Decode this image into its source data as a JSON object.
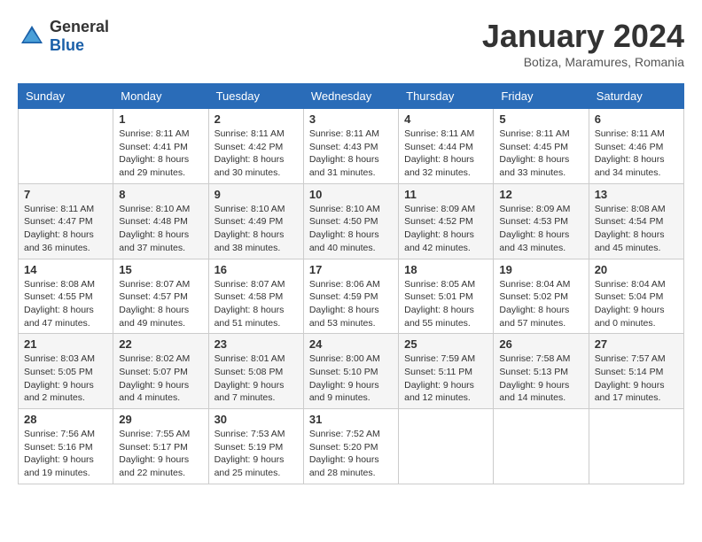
{
  "header": {
    "logo_general": "General",
    "logo_blue": "Blue",
    "month_title": "January 2024",
    "location": "Botiza, Maramures, Romania"
  },
  "weekdays": [
    "Sunday",
    "Monday",
    "Tuesday",
    "Wednesday",
    "Thursday",
    "Friday",
    "Saturday"
  ],
  "weeks": [
    [
      {
        "day": "",
        "sunrise": "",
        "sunset": "",
        "daylight": ""
      },
      {
        "day": "1",
        "sunrise": "Sunrise: 8:11 AM",
        "sunset": "Sunset: 4:41 PM",
        "daylight": "Daylight: 8 hours and 29 minutes."
      },
      {
        "day": "2",
        "sunrise": "Sunrise: 8:11 AM",
        "sunset": "Sunset: 4:42 PM",
        "daylight": "Daylight: 8 hours and 30 minutes."
      },
      {
        "day": "3",
        "sunrise": "Sunrise: 8:11 AM",
        "sunset": "Sunset: 4:43 PM",
        "daylight": "Daylight: 8 hours and 31 minutes."
      },
      {
        "day": "4",
        "sunrise": "Sunrise: 8:11 AM",
        "sunset": "Sunset: 4:44 PM",
        "daylight": "Daylight: 8 hours and 32 minutes."
      },
      {
        "day": "5",
        "sunrise": "Sunrise: 8:11 AM",
        "sunset": "Sunset: 4:45 PM",
        "daylight": "Daylight: 8 hours and 33 minutes."
      },
      {
        "day": "6",
        "sunrise": "Sunrise: 8:11 AM",
        "sunset": "Sunset: 4:46 PM",
        "daylight": "Daylight: 8 hours and 34 minutes."
      }
    ],
    [
      {
        "day": "7",
        "sunrise": "Sunrise: 8:11 AM",
        "sunset": "Sunset: 4:47 PM",
        "daylight": "Daylight: 8 hours and 36 minutes."
      },
      {
        "day": "8",
        "sunrise": "Sunrise: 8:10 AM",
        "sunset": "Sunset: 4:48 PM",
        "daylight": "Daylight: 8 hours and 37 minutes."
      },
      {
        "day": "9",
        "sunrise": "Sunrise: 8:10 AM",
        "sunset": "Sunset: 4:49 PM",
        "daylight": "Daylight: 8 hours and 38 minutes."
      },
      {
        "day": "10",
        "sunrise": "Sunrise: 8:10 AM",
        "sunset": "Sunset: 4:50 PM",
        "daylight": "Daylight: 8 hours and 40 minutes."
      },
      {
        "day": "11",
        "sunrise": "Sunrise: 8:09 AM",
        "sunset": "Sunset: 4:52 PM",
        "daylight": "Daylight: 8 hours and 42 minutes."
      },
      {
        "day": "12",
        "sunrise": "Sunrise: 8:09 AM",
        "sunset": "Sunset: 4:53 PM",
        "daylight": "Daylight: 8 hours and 43 minutes."
      },
      {
        "day": "13",
        "sunrise": "Sunrise: 8:08 AM",
        "sunset": "Sunset: 4:54 PM",
        "daylight": "Daylight: 8 hours and 45 minutes."
      }
    ],
    [
      {
        "day": "14",
        "sunrise": "Sunrise: 8:08 AM",
        "sunset": "Sunset: 4:55 PM",
        "daylight": "Daylight: 8 hours and 47 minutes."
      },
      {
        "day": "15",
        "sunrise": "Sunrise: 8:07 AM",
        "sunset": "Sunset: 4:57 PM",
        "daylight": "Daylight: 8 hours and 49 minutes."
      },
      {
        "day": "16",
        "sunrise": "Sunrise: 8:07 AM",
        "sunset": "Sunset: 4:58 PM",
        "daylight": "Daylight: 8 hours and 51 minutes."
      },
      {
        "day": "17",
        "sunrise": "Sunrise: 8:06 AM",
        "sunset": "Sunset: 4:59 PM",
        "daylight": "Daylight: 8 hours and 53 minutes."
      },
      {
        "day": "18",
        "sunrise": "Sunrise: 8:05 AM",
        "sunset": "Sunset: 5:01 PM",
        "daylight": "Daylight: 8 hours and 55 minutes."
      },
      {
        "day": "19",
        "sunrise": "Sunrise: 8:04 AM",
        "sunset": "Sunset: 5:02 PM",
        "daylight": "Daylight: 8 hours and 57 minutes."
      },
      {
        "day": "20",
        "sunrise": "Sunrise: 8:04 AM",
        "sunset": "Sunset: 5:04 PM",
        "daylight": "Daylight: 9 hours and 0 minutes."
      }
    ],
    [
      {
        "day": "21",
        "sunrise": "Sunrise: 8:03 AM",
        "sunset": "Sunset: 5:05 PM",
        "daylight": "Daylight: 9 hours and 2 minutes."
      },
      {
        "day": "22",
        "sunrise": "Sunrise: 8:02 AM",
        "sunset": "Sunset: 5:07 PM",
        "daylight": "Daylight: 9 hours and 4 minutes."
      },
      {
        "day": "23",
        "sunrise": "Sunrise: 8:01 AM",
        "sunset": "Sunset: 5:08 PM",
        "daylight": "Daylight: 9 hours and 7 minutes."
      },
      {
        "day": "24",
        "sunrise": "Sunrise: 8:00 AM",
        "sunset": "Sunset: 5:10 PM",
        "daylight": "Daylight: 9 hours and 9 minutes."
      },
      {
        "day": "25",
        "sunrise": "Sunrise: 7:59 AM",
        "sunset": "Sunset: 5:11 PM",
        "daylight": "Daylight: 9 hours and 12 minutes."
      },
      {
        "day": "26",
        "sunrise": "Sunrise: 7:58 AM",
        "sunset": "Sunset: 5:13 PM",
        "daylight": "Daylight: 9 hours and 14 minutes."
      },
      {
        "day": "27",
        "sunrise": "Sunrise: 7:57 AM",
        "sunset": "Sunset: 5:14 PM",
        "daylight": "Daylight: 9 hours and 17 minutes."
      }
    ],
    [
      {
        "day": "28",
        "sunrise": "Sunrise: 7:56 AM",
        "sunset": "Sunset: 5:16 PM",
        "daylight": "Daylight: 9 hours and 19 minutes."
      },
      {
        "day": "29",
        "sunrise": "Sunrise: 7:55 AM",
        "sunset": "Sunset: 5:17 PM",
        "daylight": "Daylight: 9 hours and 22 minutes."
      },
      {
        "day": "30",
        "sunrise": "Sunrise: 7:53 AM",
        "sunset": "Sunset: 5:19 PM",
        "daylight": "Daylight: 9 hours and 25 minutes."
      },
      {
        "day": "31",
        "sunrise": "Sunrise: 7:52 AM",
        "sunset": "Sunset: 5:20 PM",
        "daylight": "Daylight: 9 hours and 28 minutes."
      },
      {
        "day": "",
        "sunrise": "",
        "sunset": "",
        "daylight": ""
      },
      {
        "day": "",
        "sunrise": "",
        "sunset": "",
        "daylight": ""
      },
      {
        "day": "",
        "sunrise": "",
        "sunset": "",
        "daylight": ""
      }
    ]
  ]
}
